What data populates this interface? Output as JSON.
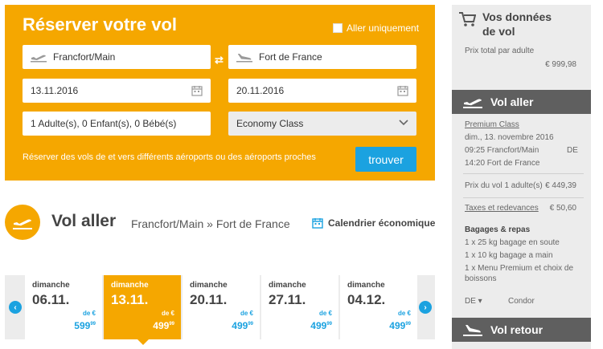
{
  "booking": {
    "title": "Réserver votre vol",
    "oneway_label": "Aller uniquement",
    "from": "Francfort/Main",
    "to": "Fort de France",
    "depart_date": "13.11.2016",
    "return_date": "20.11.2016",
    "passengers": "1 Adulte(s), 0 Enfant(s), 0 Bébé(s)",
    "cabin_class": "Economy Class",
    "hint": "Réserver des vols de et vers différents aéroports ou des aéroports proches",
    "search_label": "trouver",
    "swap_symbol": "⇄"
  },
  "outbound": {
    "title": "Vol aller",
    "route": "Francfort/Main » Fort de France",
    "calendar_label": "Calendrier économique"
  },
  "days": [
    {
      "weekday": "dimanche",
      "date": "06.11.",
      "prefix": "de €",
      "price": "599",
      "cents": "99"
    },
    {
      "weekday": "dimanche",
      "date": "13.11.",
      "prefix": "de €",
      "price": "499",
      "cents": "99"
    },
    {
      "weekday": "dimanche",
      "date": "20.11.",
      "prefix": "de €",
      "price": "499",
      "cents": "99"
    },
    {
      "weekday": "dimanche",
      "date": "27.11.",
      "prefix": "de €",
      "price": "499",
      "cents": "99"
    },
    {
      "weekday": "dimanche",
      "date": "04.12.",
      "prefix": "de €",
      "price": "499",
      "cents": "99"
    }
  ],
  "nav": {
    "prev": "‹",
    "next": "›"
  },
  "sidebar": {
    "title_line1": "Vos données",
    "title_line2": "de vol",
    "total_label": "Prix total par adulte",
    "total_value": "€ 999,98",
    "outbound_bar": "Vol aller",
    "class": "Premium Class",
    "date": "dim., 13. novembre 2016",
    "dep_line": "09:25 Francfort/Main",
    "dep_country": "DE",
    "arr_line": "14:20 Fort de France",
    "flight_price_label": "Prix du vol 1 adulte(s)",
    "flight_price_value": "€ 449,39",
    "taxes_label": "Taxes et redevances",
    "taxes_value": "€ 50,60",
    "baggage_title": "Bagages & repas",
    "baggage_1": "1 x 25 kg bagage en soute",
    "baggage_2": "1 x 10 kg bagage a main",
    "baggage_3": "1 x Menu Premium et choix de",
    "baggage_3b": "boissons",
    "carrier_code": "DE ▾",
    "carrier_name": "Condor",
    "return_bar": "Vol retour"
  },
  "colors": {
    "brand_orange": "#f5a700",
    "accent_blue": "#1ba2e0",
    "sidebar_bar": "#5f5f5f"
  }
}
